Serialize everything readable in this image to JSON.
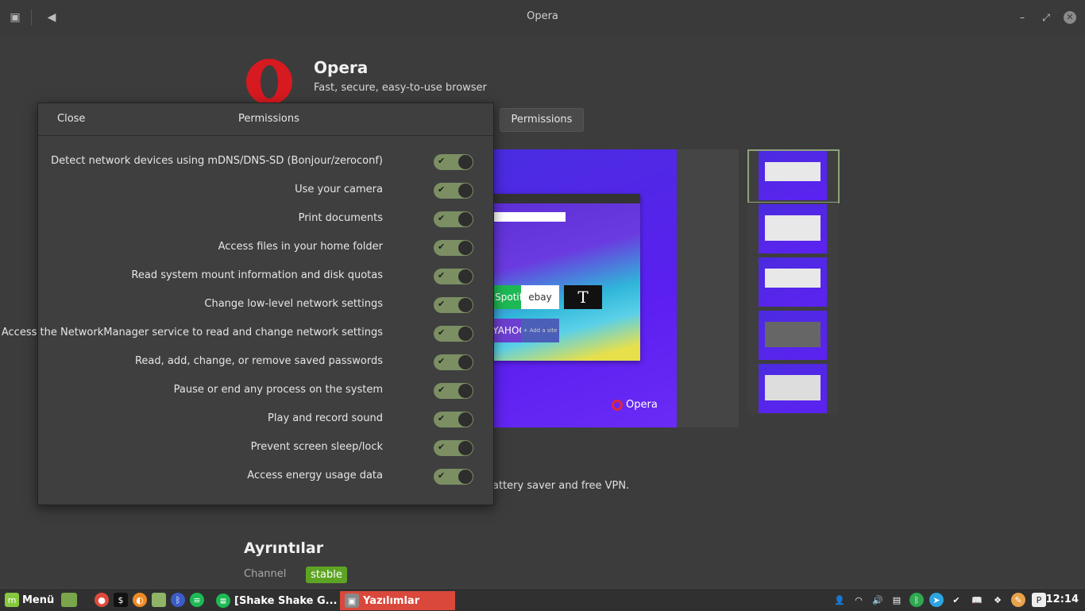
{
  "window": {
    "title": "Opera"
  },
  "app": {
    "name": "Opera",
    "subtitle": "Fast, secure, easy-to-use browser",
    "permissions_button": "Permissions"
  },
  "screenshot": {
    "brand": "Opera",
    "tiles": [
      "Spotify",
      "ebay",
      "T",
      "YAHOO!",
      "+ Add a site"
    ]
  },
  "description_tail": "attery saver and free VPN.",
  "details": {
    "heading": "Ayrıntılar",
    "channel_label": "Channel",
    "channel_value": "stable"
  },
  "dialog": {
    "close_label": "Close",
    "title": "Permissions",
    "permissions": [
      {
        "label": "Detect network devices using mDNS/DNS-SD (Bonjour/zeroconf)",
        "enabled": true
      },
      {
        "label": "Use your camera",
        "enabled": true
      },
      {
        "label": "Print documents",
        "enabled": true
      },
      {
        "label": "Access files in your home folder",
        "enabled": true
      },
      {
        "label": "Read system mount information and disk quotas",
        "enabled": true
      },
      {
        "label": "Change low-level network settings",
        "enabled": true
      },
      {
        "label": "Access the NetworkManager service to read and change network settings",
        "enabled": true
      },
      {
        "label": "Read, add, change, or remove saved passwords",
        "enabled": true
      },
      {
        "label": "Pause or end any process on the system",
        "enabled": true
      },
      {
        "label": "Play and record sound",
        "enabled": true
      },
      {
        "label": "Prevent screen sleep/lock",
        "enabled": true
      },
      {
        "label": "Access energy usage data",
        "enabled": true
      }
    ]
  },
  "taskbar": {
    "menu_label": "Menü",
    "tasks": [
      "[Shake Shake G...",
      "Yazılımlar"
    ],
    "clock": "12:14"
  },
  "colors": {
    "accent": "#7b8f63",
    "badge": "#5ea424",
    "active_task": "#d9483b"
  }
}
